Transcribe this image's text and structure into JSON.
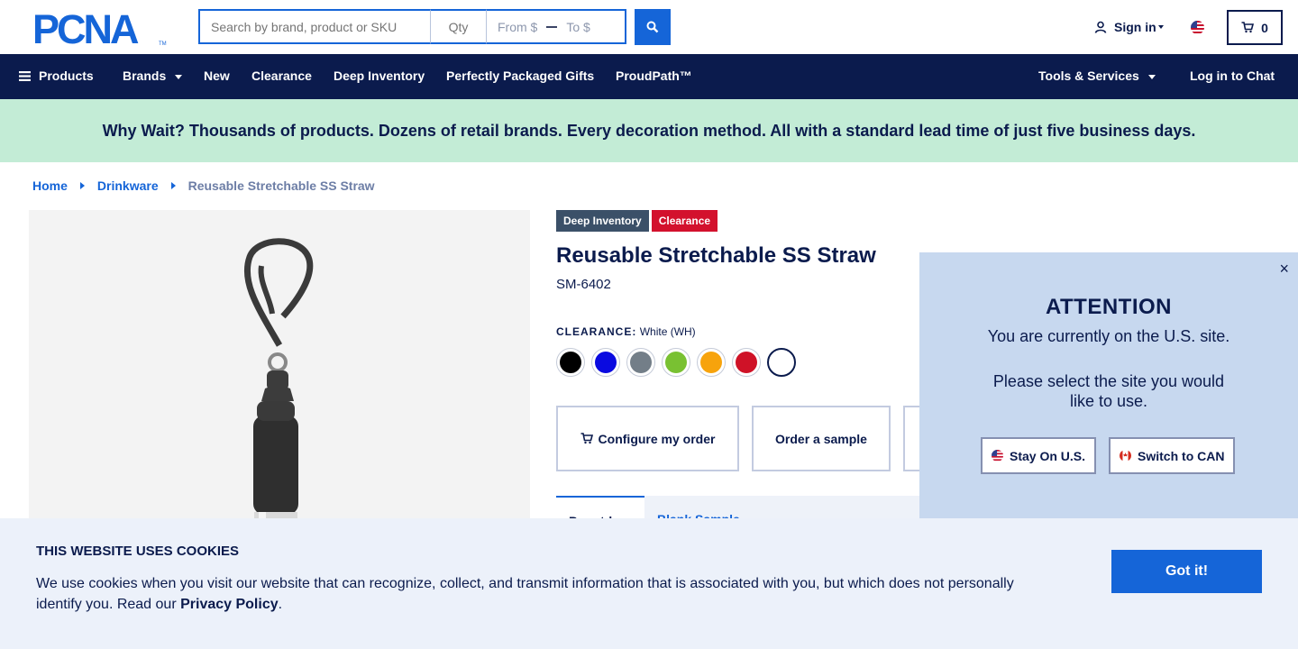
{
  "header": {
    "logo_text": "PCNA",
    "search_placeholder": "Search by brand, product or SKU",
    "qty_placeholder": "Qty",
    "price_from_placeholder": "From $",
    "price_to_placeholder": "To $",
    "signin_label": "Sign in",
    "cart_count": "0"
  },
  "nav": {
    "products": "Products",
    "brands": "Brands",
    "new": "New",
    "clearance": "Clearance",
    "deep_inventory": "Deep Inventory",
    "gifts": "Perfectly Packaged Gifts",
    "proudpath": "ProudPath™",
    "tools": "Tools & Services",
    "chat": "Log in to Chat"
  },
  "promo": "Why Wait? Thousands of products. Dozens of retail brands. Every decoration method. All with a standard lead time of just five business days.",
  "breadcrumb": {
    "home": "Home",
    "category": "Drinkware",
    "current": "Reusable Stretchable SS Straw"
  },
  "product": {
    "badges": [
      "Deep Inventory",
      "Clearance"
    ],
    "title": "Reusable Stretchable SS Straw",
    "sku": "SM-6402",
    "color_label": "CLEARANCE:",
    "color_value": "White (WH)",
    "swatch_colors": [
      "#000000",
      "#0a0ae0",
      "#737e88",
      "#79c132",
      "#f7a30c",
      "#cf1227",
      "#ffffff"
    ],
    "actions": {
      "configure": "Configure my order",
      "sample": "Order a sample"
    },
    "tabs": [
      "Pre-ctd",
      "Blank Sample"
    ]
  },
  "attention": {
    "title": "ATTENTION",
    "line1": "You are currently on the U.S. site.",
    "line2": "Please select the site you would like to use.",
    "stay_label": "Stay On U.S.",
    "switch_label": "Switch to CAN",
    "close": "×"
  },
  "cookie": {
    "title": "THIS WEBSITE USES COOKIES",
    "text": "We use cookies when you visit our website that can recognize, collect, and transmit information that is associated with you, but which does not personally identify you. Read our ",
    "link": "Privacy Policy",
    "period": ".",
    "button": "Got it!"
  },
  "colors": {
    "navy": "#0b1b4d",
    "blue": "#1565d8",
    "promo_bg": "#c3ecd6",
    "clearance_red": "#d3112d"
  }
}
